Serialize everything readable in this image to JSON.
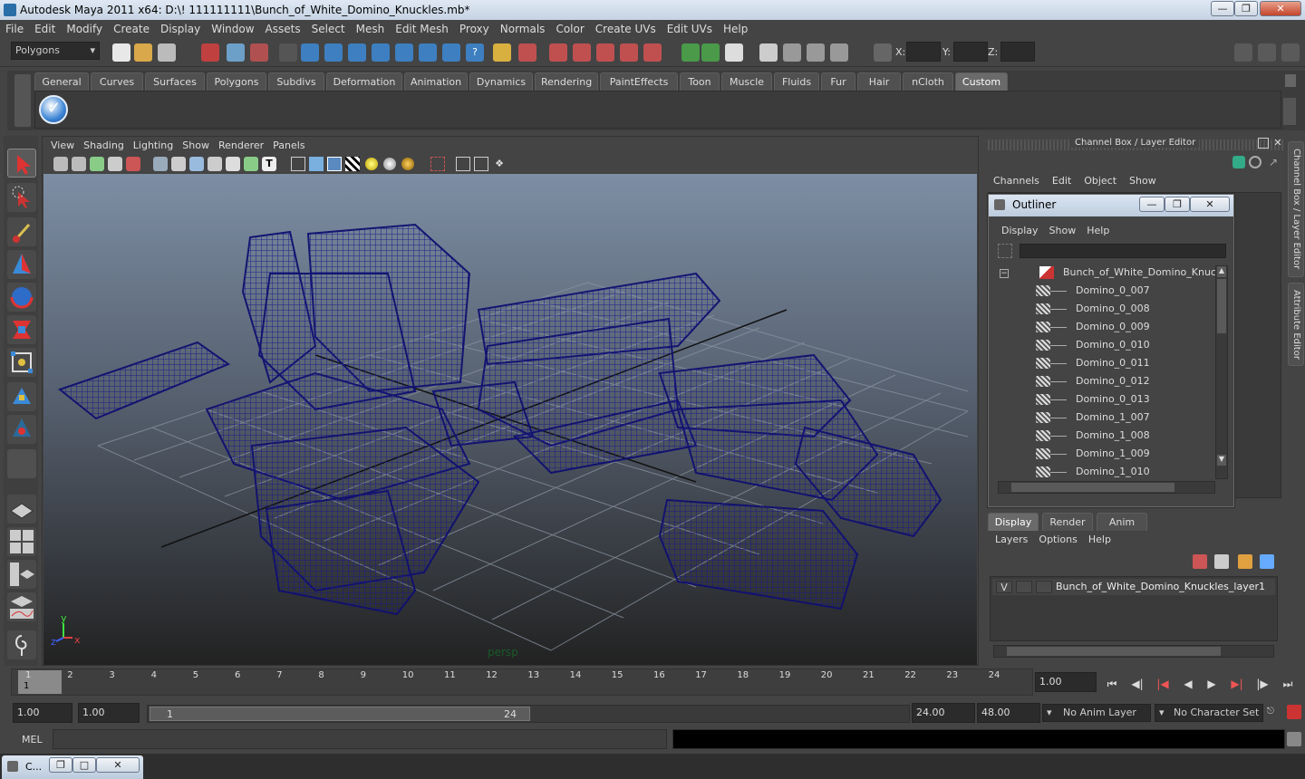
{
  "title": "Autodesk Maya 2011 x64: D:\\! 111111111\\Bunch_of_White_Domino_Knuckles.mb*",
  "menus": [
    "File",
    "Edit",
    "Modify",
    "Create",
    "Display",
    "Window",
    "Assets",
    "Select",
    "Mesh",
    "Edit Mesh",
    "Proxy",
    "Normals",
    "Color",
    "Create UVs",
    "Edit UVs",
    "Help"
  ],
  "mode_select": "Polygons",
  "coords": {
    "x": "X:",
    "y": "Y:",
    "z": "Z:"
  },
  "shelf_tabs": [
    "General",
    "Curves",
    "Surfaces",
    "Polygons",
    "Subdivs",
    "Deformation",
    "Animation",
    "Dynamics",
    "Rendering",
    "PaintEffects",
    "Toon",
    "Muscle",
    "Fluids",
    "Fur",
    "Hair",
    "nCloth",
    "Custom"
  ],
  "shelf_active": "Custom",
  "viewport_menu": [
    "View",
    "Shading",
    "Lighting",
    "Show",
    "Renderer",
    "Panels"
  ],
  "viewport_camera": "persp",
  "axis": {
    "y": "y",
    "x": "x",
    "z": "z"
  },
  "channel_box": {
    "title": "Channel Box / Layer Editor",
    "menu": [
      "Channels",
      "Edit",
      "Object",
      "Show"
    ]
  },
  "outliner": {
    "title": "Outliner",
    "menu": [
      "Display",
      "Show",
      "Help"
    ],
    "root": "Bunch_of_White_Domino_Knuckles",
    "items": [
      "Domino_0_007",
      "Domino_0_008",
      "Domino_0_009",
      "Domino_0_010",
      "Domino_0_011",
      "Domino_0_012",
      "Domino_0_013",
      "Domino_1_007",
      "Domino_1_008",
      "Domino_1_009",
      "Domino_1_010"
    ]
  },
  "layer_editor": {
    "tabs": [
      "Display",
      "Render",
      "Anim"
    ],
    "active_tab": "Display",
    "menu": [
      "Layers",
      "Options",
      "Help"
    ],
    "layer_visible": "V",
    "layer_name": "Bunch_of_White_Domino_Knuckles_layer1"
  },
  "side_tabs": [
    "Channel Box / Layer Editor",
    "Attribute Editor"
  ],
  "timeline": {
    "ticks": [
      "1",
      "2",
      "3",
      "4",
      "5",
      "6",
      "7",
      "8",
      "9",
      "10",
      "11",
      "12",
      "13",
      "14",
      "15",
      "16",
      "17",
      "18",
      "19",
      "20",
      "21",
      "22",
      "23",
      "24"
    ],
    "current_marker": "1",
    "current_frame": "1.00"
  },
  "range": {
    "start": "1.00",
    "playback_start": "1.00",
    "slider_start": "1",
    "slider_end": "24",
    "playback_end": "24.00",
    "end": "48.00",
    "anim_layer": "No Anim Layer",
    "character_set": "No Character Set"
  },
  "command_line": {
    "label": "MEL"
  },
  "taskbar": {
    "label": "C..."
  }
}
